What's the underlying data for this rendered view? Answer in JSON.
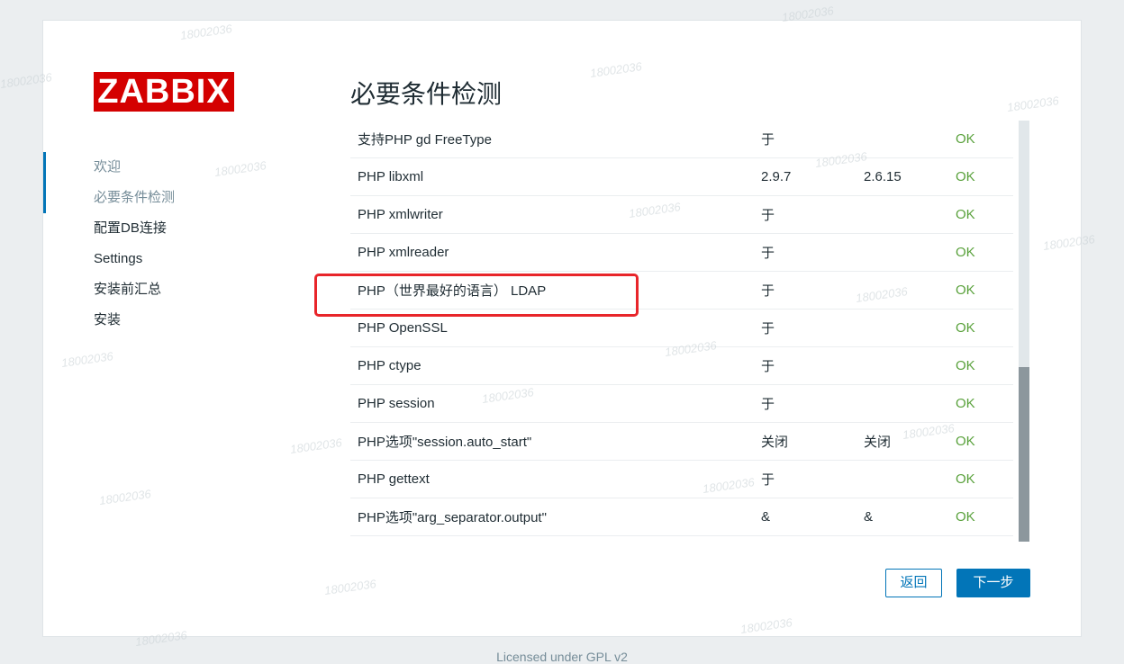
{
  "logo": "ZABBIX",
  "page_title": "必要条件检测",
  "steps": [
    {
      "label": "欢迎"
    },
    {
      "label": "必要条件检测"
    },
    {
      "label": "配置DB连接"
    },
    {
      "label": "Settings"
    },
    {
      "label": "安装前汇总"
    },
    {
      "label": "安装"
    }
  ],
  "rows": [
    {
      "name": "支持PHP gd FreeType",
      "current": "于",
      "required": "",
      "status": "OK"
    },
    {
      "name": "PHP libxml",
      "current": "2.9.7",
      "required": "2.6.15",
      "status": "OK"
    },
    {
      "name": "PHP xmlwriter",
      "current": "于",
      "required": "",
      "status": "OK"
    },
    {
      "name": "PHP xmlreader",
      "current": "于",
      "required": "",
      "status": "OK"
    },
    {
      "name": "PHP（世界最好的语言） LDAP",
      "current": "于",
      "required": "",
      "status": "OK"
    },
    {
      "name": "PHP OpenSSL",
      "current": "于",
      "required": "",
      "status": "OK"
    },
    {
      "name": "PHP ctype",
      "current": "于",
      "required": "",
      "status": "OK"
    },
    {
      "name": "PHP session",
      "current": "于",
      "required": "",
      "status": "OK"
    },
    {
      "name": "PHP选项\"session.auto_start\"",
      "current": "关闭",
      "required": "关闭",
      "status": "OK"
    },
    {
      "name": "PHP gettext",
      "current": "于",
      "required": "",
      "status": "OK"
    },
    {
      "name": "PHP选项\"arg_separator.output\"",
      "current": "&",
      "required": "&",
      "status": "OK"
    }
  ],
  "buttons": {
    "back": "返回",
    "next": "下一步"
  },
  "footer": "Licensed under GPL v2",
  "watermark": "18002036",
  "colors": {
    "accent": "#0275b8",
    "ok": "#59a13b",
    "logo_bg": "#d40000",
    "highlight": "#e8252a"
  }
}
